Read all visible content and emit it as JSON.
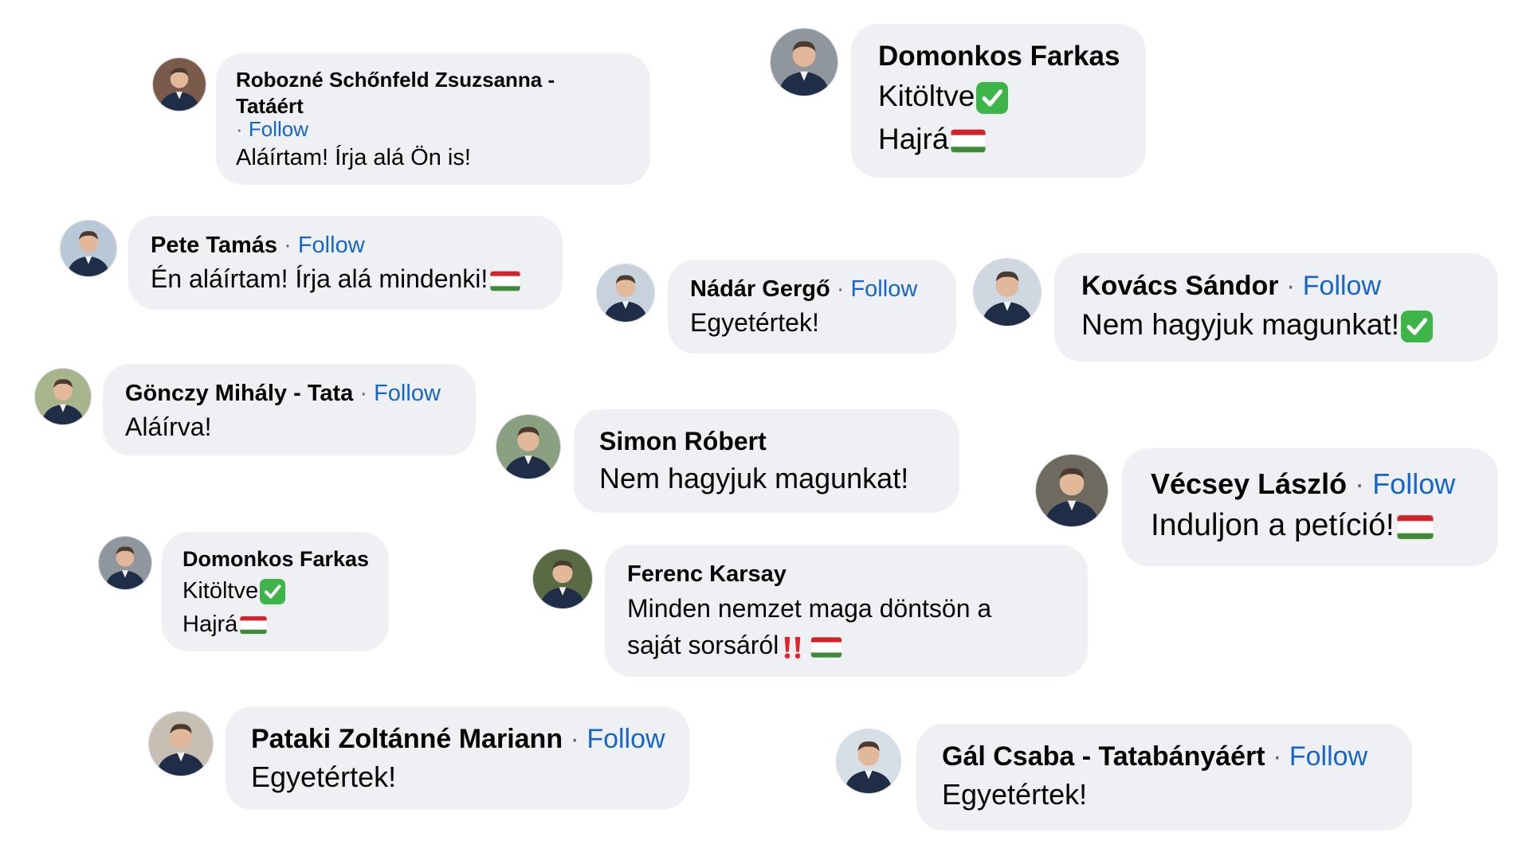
{
  "common": {
    "follow": "Follow",
    "dot": "·"
  },
  "comments": [
    {
      "name": "Robozné Schőnfeld Zsuzsanna - Tatáért",
      "follow": "Follow",
      "lines": [
        "Aláírtam! Írja alá Ön is!"
      ]
    },
    {
      "name": "Domonkos Farkas",
      "lines": [
        "Kitöltve",
        "Hajrá"
      ],
      "icons": [
        "check-emoji",
        "hungarian-flag"
      ]
    },
    {
      "name": "Pete Tamás",
      "follow": "Follow",
      "lines": [
        "Én aláírtam! Írja alá mindenki!"
      ],
      "icons": [
        "hungarian-flag"
      ]
    },
    {
      "name": "Nádár Gergő",
      "follow": "Follow",
      "lines": [
        "Egyetértek!"
      ]
    },
    {
      "name": "Kovács Sándor",
      "follow": "Follow",
      "lines": [
        "Nem hagyjuk magunkat!"
      ],
      "icons": [
        "check-emoji"
      ]
    },
    {
      "name": "Gönczy Mihály - Tata",
      "follow": "Follow",
      "lines": [
        "Aláírva!"
      ]
    },
    {
      "name": "Simon Róbert",
      "lines": [
        "Nem hagyjuk magunkat!"
      ]
    },
    {
      "name": "Vécsey László",
      "follow": "Follow",
      "lines": [
        "Induljon a petíció!"
      ],
      "icons": [
        "hungarian-flag"
      ]
    },
    {
      "name": "Domonkos Farkas",
      "lines": [
        "Kitöltve",
        "Hajrá"
      ],
      "icons": [
        "check-emoji",
        "hungarian-flag"
      ]
    },
    {
      "name": "Ferenc Karsay",
      "lines": [
        "Minden nemzet maga döntsön a",
        "saját sorsáról"
      ],
      "icons": [
        "double-exclamation-emoji",
        "hungarian-flag"
      ]
    },
    {
      "name": "Pataki Zoltánné Mariann",
      "follow": "Follow",
      "lines": [
        "Egyetértek!"
      ]
    },
    {
      "name": "Gál Csaba - Tatabányáért",
      "follow": "Follow",
      "lines": [
        "Egyetértek!"
      ]
    }
  ],
  "colors": {
    "bubble": "#eff0f3",
    "follow": "#1466cc",
    "text": "#050505",
    "meta": "#65676b"
  }
}
